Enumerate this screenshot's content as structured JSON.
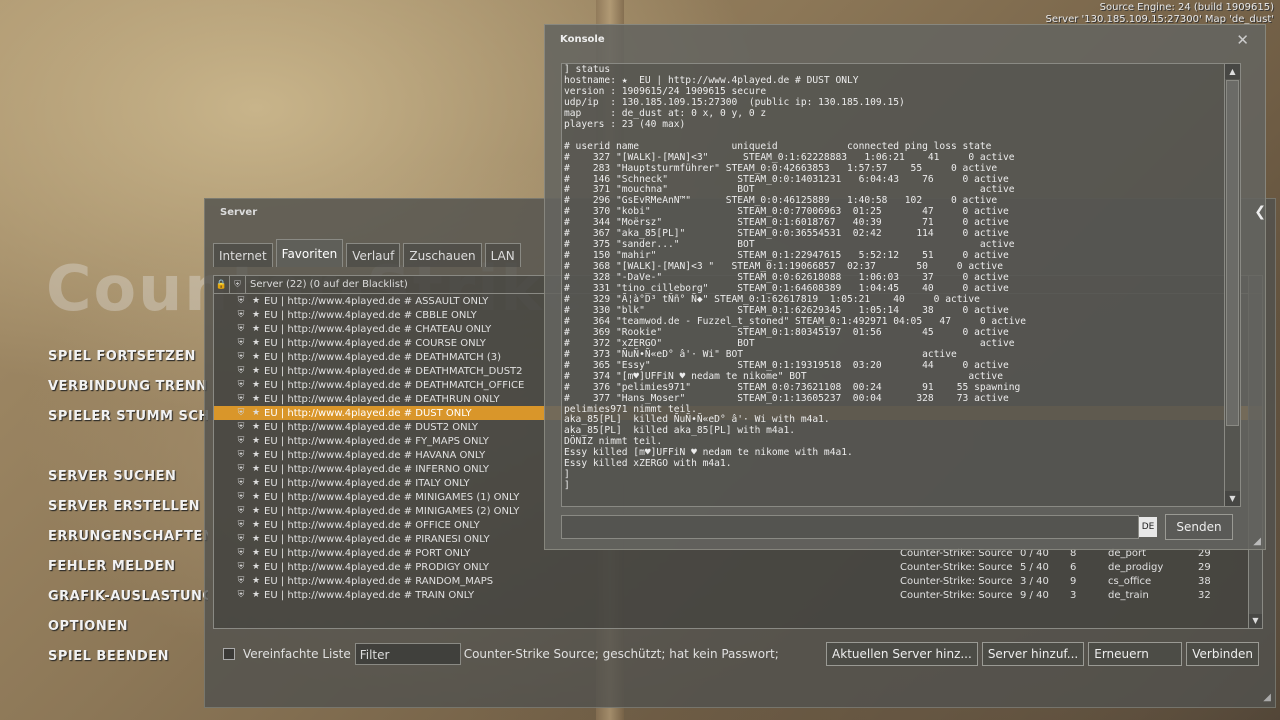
{
  "engine": {
    "line1": "Source Engine: 24 (build 1909615)",
    "line2": "Server '130.185.109.15:27300' Map 'de_dust'"
  },
  "logo_text": "Counter-Strike",
  "main_menu": {
    "items": [
      "SPIEL FORTSETZEN",
      "VERBINDUNG TRENNEN",
      "SPIELER STUMM SCHALTEN",
      "SERVER SUCHEN",
      "SERVER ERSTELLEN",
      "ERRUNGENSCHAFTEN",
      "FEHLER MELDEN",
      "GRAFIK-AUSLASTUNG",
      "OPTIONEN",
      "SPIEL BEENDEN"
    ]
  },
  "server_browser": {
    "title": "Server",
    "tabs": [
      "Internet",
      "Favoriten",
      "Verlauf",
      "Zuschauen",
      "LAN"
    ],
    "list_header": "Server (22) (0 auf der Blacklist)",
    "header_icons": [
      "lock-icon",
      "shield-icon"
    ],
    "servers": [
      {
        "name": "EU | http://www.4played.de # ASSAULT ONLY",
        "game": "",
        "players": "",
        "ping": "",
        "map": "",
        "lat": ""
      },
      {
        "name": "EU | http://www.4played.de # CBBLE ONLY",
        "game": "",
        "players": "",
        "ping": "",
        "map": "",
        "lat": ""
      },
      {
        "name": "EU | http://www.4played.de # CHATEAU ONLY",
        "game": "",
        "players": "",
        "ping": "",
        "map": "",
        "lat": ""
      },
      {
        "name": "EU | http://www.4played.de # COURSE ONLY",
        "game": "",
        "players": "",
        "ping": "",
        "map": "",
        "lat": ""
      },
      {
        "name": "EU | http://www.4played.de # DEATHMATCH (3)",
        "game": "",
        "players": "",
        "ping": "",
        "map": "",
        "lat": ""
      },
      {
        "name": "EU | http://www.4played.de # DEATHMATCH_DUST2",
        "game": "",
        "players": "",
        "ping": "",
        "map": "",
        "lat": ""
      },
      {
        "name": "EU | http://www.4played.de # DEATHMATCH_OFFICE",
        "game": "",
        "players": "",
        "ping": "",
        "map": "",
        "lat": ""
      },
      {
        "name": "EU | http://www.4played.de # DEATHRUN ONLY",
        "game": "",
        "players": "",
        "ping": "",
        "map": "",
        "lat": ""
      },
      {
        "name": "EU | http://www.4played.de # DUST ONLY",
        "game": "",
        "players": "",
        "ping": "",
        "map": "",
        "lat": "",
        "selected": true
      },
      {
        "name": "EU | http://www.4played.de # DUST2 ONLY",
        "game": "",
        "players": "",
        "ping": "",
        "map": "",
        "lat": ""
      },
      {
        "name": "EU | http://www.4played.de # FY_MAPS ONLY",
        "game": "",
        "players": "",
        "ping": "",
        "map": "",
        "lat": ""
      },
      {
        "name": "EU | http://www.4played.de # HAVANA ONLY",
        "game": "",
        "players": "",
        "ping": "",
        "map": "",
        "lat": ""
      },
      {
        "name": "EU | http://www.4played.de # INFERNO ONLY",
        "game": "",
        "players": "",
        "ping": "",
        "map": "",
        "lat": ""
      },
      {
        "name": "EU | http://www.4played.de # ITALY ONLY",
        "game": "",
        "players": "",
        "ping": "",
        "map": "",
        "lat": ""
      },
      {
        "name": "EU | http://www.4played.de # MINIGAMES (1) ONLY",
        "game": "",
        "players": "",
        "ping": "",
        "map": "",
        "lat": ""
      },
      {
        "name": "EU | http://www.4played.de # MINIGAMES (2) ONLY",
        "game": "",
        "players": "",
        "ping": "",
        "map": "",
        "lat": ""
      },
      {
        "name": "EU | http://www.4played.de # OFFICE ONLY",
        "game": "",
        "players": "",
        "ping": "",
        "map": "",
        "lat": ""
      },
      {
        "name": "EU | http://www.4played.de # PIRANESI ONLY",
        "game": "",
        "players": "",
        "ping": "",
        "map": "",
        "lat": ""
      },
      {
        "name": "EU | http://www.4played.de # PORT ONLY",
        "game": "Counter-Strike: Source",
        "players": "0 / 40",
        "ping": "8",
        "map": "de_port",
        "lat": "29"
      },
      {
        "name": "EU | http://www.4played.de # PRODIGY ONLY",
        "game": "Counter-Strike: Source",
        "players": "5 / 40",
        "ping": "6",
        "map": "de_prodigy",
        "lat": "29"
      },
      {
        "name": "EU | http://www.4played.de # RANDOM_MAPS",
        "game": "Counter-Strike: Source",
        "players": "3 / 40",
        "ping": "9",
        "map": "cs_office",
        "lat": "38"
      },
      {
        "name": "EU | http://www.4played.de # TRAIN ONLY",
        "game": "Counter-Strike: Source",
        "players": "9 / 40",
        "ping": "3",
        "map": "de_train",
        "lat": "32"
      }
    ],
    "simple_list_label": "Vereinfachte Liste",
    "filter_label": "Filter",
    "status": "Counter-Strike Source; geschützt; hat kein Passwort;",
    "buttons": [
      "Aktuellen Server hinz...",
      "Server hinzuf...",
      "Erneuern",
      "Verbinden"
    ]
  },
  "console": {
    "title": "Konsole",
    "lines": [
      "] status",
      "hostname: ★  EU | http://www.4played.de # DUST ONLY",
      "version : 1909615/24 1909615 secure",
      "udp/ip  : 130.185.109.15:27300  (public ip: 130.185.109.15)",
      "map     : de_dust at: 0 x, 0 y, 0 z",
      "players : 23 (40 max)",
      "",
      "# userid name                uniqueid            connected ping loss state",
      "#    327 \"[WALK]-[MAN]<3\"      STEAM_0:1:62228883   1:06:21    41     0 active",
      "#    283 \"Hauptsturmführer\" STEAM_0:0:42663853   1:57:57    55     0 active",
      "#    146 \"Schneck\"            STEAM_0:0:14031231   6:04:43    76     0 active",
      "#    371 \"mouchna\"            BOT                                       active",
      "#    296 \"GsEvRMeAnN™\"      STEAM_0:0:46125889   1:40:58   102     0 active",
      "#    370 \"kobi\"               STEAM_0:0:77006963  01:25       47     0 active",
      "#    344 \"Moërsz\"             STEAM_0:1:6018767   40:39       71     0 active",
      "#    367 \"aka_85[PL]\"         STEAM_0:0:36554531  02:42      114     0 active",
      "#    375 \"sander...\"          BOT                                       active",
      "#    150 \"mahir\"              STEAM_0:1:22947615   5:52:12    51     0 active",
      "#    368 \"[WALK]-[MAN]<3 \"   STEAM_0:1:19066857  02:37       50     0 active",
      "#    328 \"-DaVe-\"             STEAM_0:0:62618088   1:06:03    37     0 active",
      "#    331 \"tino_cilleborg\"     STEAM_0:1:64608389   1:04:45    40     0 active",
      "#    329 \"Ã¦à°D³ tÑñ° Ñ◆\" STEAM_0:1:62617819  1:05:21    40     0 active",
      "#    330 \"blk\"                STEAM_0:1:62629345   1:05:14    38     0 active",
      "#    364 \"teamwod.de - Fuzzel_t_stoned\" STEAM_0:1:492971 04:05   47     0 active",
      "#    369 \"Rookie\"             STEAM_0:1:80345197  01:56       45     0 active",
      "#    372 \"xZERGO\"             BOT                                       active",
      "#    373 \"ÑuÑ•Ñ«eD° â'· Wi\" BOT                               active",
      "#    365 \"Essy\"               STEAM_0:1:19319518  03:20       44     0 active",
      "#    374 \"[m♥]UFFiN ♥ nedam te nikome\" BOT                            active",
      "#    376 \"pelimies971\"        STEAM_0:0:73621108  00:24       91    55 spawning",
      "#    377 \"Hans_Moser\"         STEAM_0:1:13605237  00:04      328    73 active",
      "pelimies971 nimmt teil.",
      "aka_85[PL]  killed ÑuÑ•Ñ«eD° â'· Wi with m4a1.",
      "aka_85[PL]  killed aka_85[PL] with m4a1.",
      "DÖNIZ nimmt teil.",
      "Essy killed [m♥]UFFiN ♥ nedam te nikome with m4a1.",
      "Essy killed xZERGO with m4a1.",
      "]",
      "]"
    ],
    "input_value": "",
    "lang": "DE",
    "send_label": "Senden"
  }
}
